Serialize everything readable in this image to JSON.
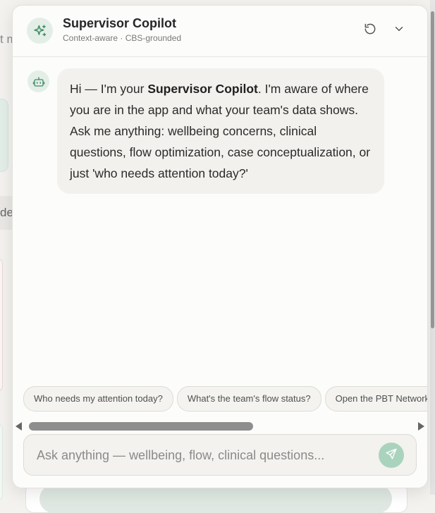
{
  "background": {
    "fragment_top": "t m",
    "fragment_mid": "de"
  },
  "header": {
    "title": "Supervisor Copilot",
    "subtitle": "Context-aware · CBS-grounded",
    "icon": "sparkles-icon",
    "reset_icon": "refresh-icon",
    "collapse_icon": "chevron-down-icon"
  },
  "message": {
    "avatar_icon": "bot-icon",
    "intro": "Hi — I'm your ",
    "bold": "Supervisor Copilot",
    "body": ". I'm aware of where you are in the app and what your team's data shows. Ask me anything: wellbeing concerns, clinical questions, flow optimization, case conceptualization, or just 'who needs attention today?'"
  },
  "suggestions": [
    "Who needs my attention today?",
    "What's the team's flow status?",
    "Open the PBT Network"
  ],
  "composer": {
    "placeholder": "Ask anything — wellbeing, flow, clinical questions...",
    "send_icon": "send-icon"
  },
  "colors": {
    "accent": "#3f8a64",
    "accent_soft": "#e3eee7",
    "send_button": "#a9d3bd"
  }
}
